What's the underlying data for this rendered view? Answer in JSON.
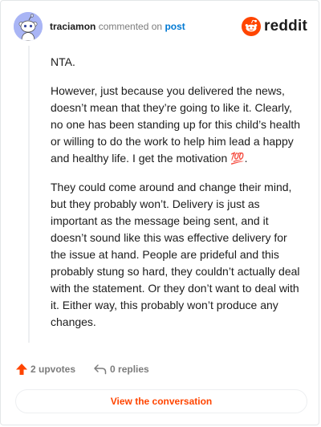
{
  "header": {
    "username": "traciamon",
    "action_text": "commented on",
    "post_link_label": "post",
    "brand_name": "reddit"
  },
  "comment": {
    "paragraphs": [
      "NTA.",
      "However, just because you delivered the news, doesn’t mean that they’re going to like it. Clearly, no one has been standing up for this child’s health or willing to do the work to help him lead a happy and healthy life. I get the motivation 💯.",
      "They could come around and change their mind, but they probably won’t. Delivery is just as important as the message being sent, and it doesn’t sound like this was effective delivery for the issue at hand. People are prideful and this probably stung so hard, they couldn’t actually deal with the statement. Or they don’t want to deal with it. Either way, this probably won’t produce any changes."
    ]
  },
  "footer": {
    "upvotes_label": "2 upvotes",
    "replies_label": "0 replies",
    "view_conversation_label": "View the conversation"
  },
  "icons": {
    "avatar": "snoo-avatar-icon",
    "brand": "reddit-logo-icon",
    "upvote": "upvote-arrow-icon",
    "reply": "reply-arrow-icon"
  },
  "colors": {
    "brand_orange": "#ff4500",
    "link_blue": "#0079d3",
    "avatar_bg": "#a9b5f5",
    "text": "#1c1c1c",
    "muted": "#7c7c7c"
  }
}
